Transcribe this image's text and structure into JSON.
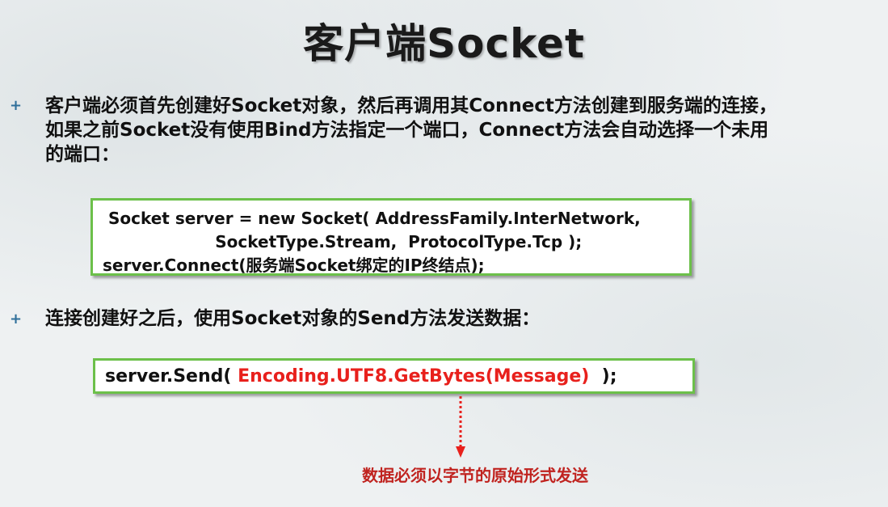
{
  "slide": {
    "title": "客户端Socket",
    "bullet_glyph": "+",
    "colors": {
      "accent_green": "#6cc04a",
      "highlight_red": "#e8201c",
      "note_red": "#c0231f",
      "bullet_blue": "#2f6f9a"
    },
    "bullets": [
      {
        "lines": [
          "客户端必须首先创建好Socket对象，然后再调用其Connect方法创建到服务端的连接，",
          "如果之前Socket没有使用Bind方法指定一个端口，Connect方法会自动选择一个未用",
          "的端口："
        ]
      },
      {
        "lines": [
          "连接创建好之后，使用Socket对象的Send方法发送数据："
        ]
      }
    ],
    "code_block_1": {
      "lines": [
        " Socket server = new Socket( AddressFamily.InterNetwork,",
        "                    SocketType.Stream,  ProtocolType.Tcp );",
        "server.Connect(服务端Socket绑定的IP终结点);"
      ]
    },
    "code_block_2": {
      "prefix": "server.Send( ",
      "highlight": "Encoding.UTF8.GetBytes(Message) ",
      "suffix": " );"
    },
    "note": "数据必须以字节的原始形式发送",
    "arrow_icon": "dotted-down-arrow-icon"
  }
}
